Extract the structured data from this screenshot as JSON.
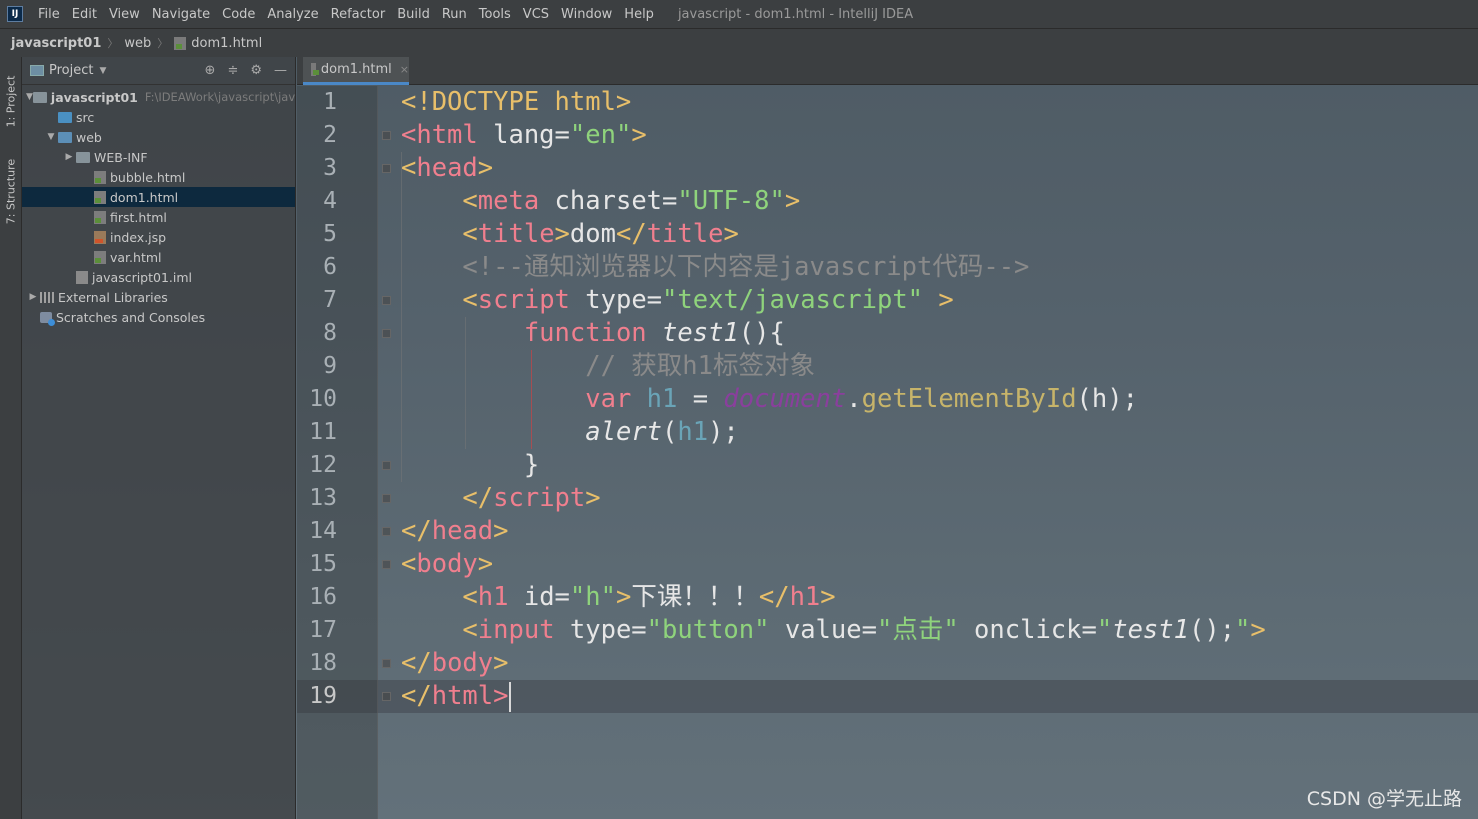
{
  "menubar": {
    "logo": "IJ",
    "items": [
      "File",
      "Edit",
      "View",
      "Navigate",
      "Code",
      "Analyze",
      "Refactor",
      "Build",
      "Run",
      "Tools",
      "VCS",
      "Window",
      "Help"
    ],
    "window_title": "javascript - dom1.html - IntelliJ IDEA"
  },
  "breadcrumb": {
    "project": "javascript01",
    "folder": "web",
    "file": "dom1.html"
  },
  "toolstrip": {
    "project_tab": "1: Project",
    "structure_tab": "7: Structure"
  },
  "project_panel": {
    "title": "Project",
    "tree": [
      {
        "label": "javascript01",
        "extra": "F:\\IDEAWork\\javascript\\jav",
        "icon": "folder-module-icon",
        "depth": 0,
        "arrow": "down"
      },
      {
        "label": "src",
        "icon": "folder-src-icon",
        "depth": 1,
        "arrow": ""
      },
      {
        "label": "web",
        "icon": "folder-web-icon",
        "depth": 1,
        "arrow": "down"
      },
      {
        "label": "WEB-INF",
        "icon": "folder-icon",
        "depth": 2,
        "arrow": "right"
      },
      {
        "label": "bubble.html",
        "icon": "html-file-icon",
        "depth": 3,
        "arrow": ""
      },
      {
        "label": "dom1.html",
        "icon": "html-file-icon",
        "depth": 3,
        "arrow": "",
        "selected": true
      },
      {
        "label": "first.html",
        "icon": "html-file-icon",
        "depth": 3,
        "arrow": ""
      },
      {
        "label": "index.jsp",
        "icon": "jsp-file-icon",
        "depth": 3,
        "arrow": ""
      },
      {
        "label": "var.html",
        "icon": "html-file-icon",
        "depth": 3,
        "arrow": ""
      },
      {
        "label": "javascript01.iml",
        "icon": "iml-file-icon",
        "depth": 2,
        "arrow": ""
      },
      {
        "label": "External Libraries",
        "icon": "library-icon",
        "depth": 0,
        "arrow": "right"
      },
      {
        "label": "Scratches and Consoles",
        "icon": "scratch-icon",
        "depth": 0,
        "arrow": ""
      }
    ]
  },
  "editor": {
    "tab": "dom1.html",
    "current_line": 19,
    "lines": [
      [
        [
          "tg",
          "<!DOCTYPE html>"
        ]
      ],
      [
        [
          "tgn",
          "<html"
        ],
        [
          "at",
          " lang="
        ],
        [
          "av",
          "\"en\""
        ],
        [
          "tg",
          ">"
        ]
      ],
      [
        [
          "tg",
          "<"
        ],
        [
          "tgn",
          "head"
        ],
        [
          "tg",
          ">"
        ]
      ],
      [
        [
          "pl",
          "    "
        ],
        [
          "tg",
          "<"
        ],
        [
          "tgn",
          "meta"
        ],
        [
          "at",
          " charset="
        ],
        [
          "av",
          "\"UTF-8\""
        ],
        [
          "tg",
          ">"
        ]
      ],
      [
        [
          "pl",
          "    "
        ],
        [
          "tg",
          "<"
        ],
        [
          "tgn",
          "title"
        ],
        [
          "tg",
          ">"
        ],
        [
          "pl",
          "dom"
        ],
        [
          "tg",
          "</"
        ],
        [
          "tgn",
          "title"
        ],
        [
          "tg",
          ">"
        ]
      ],
      [
        [
          "pl",
          "    "
        ],
        [
          "cm",
          "<!--通知浏览器以下内容是javascript代码-->"
        ]
      ],
      [
        [
          "pl",
          "    "
        ],
        [
          "tg",
          "<"
        ],
        [
          "tgn",
          "script"
        ],
        [
          "at",
          " type="
        ],
        [
          "av",
          "\"text/javascript\""
        ],
        [
          "tg",
          " >"
        ]
      ],
      [
        [
          "pl",
          "        "
        ],
        [
          "kw",
          "function"
        ],
        [
          "fn",
          " test1"
        ],
        [
          "pl",
          "(){"
        ]
      ],
      [
        [
          "pl",
          "            "
        ],
        [
          "cm",
          "// 获取h1标签对象"
        ]
      ],
      [
        [
          "pl",
          "            "
        ],
        [
          "kw",
          "var"
        ],
        [
          "var",
          " h1"
        ],
        [
          "pl",
          " = "
        ],
        [
          "doc",
          "document"
        ],
        [
          "pl",
          "."
        ],
        [
          "meth",
          "getElementById"
        ],
        [
          "pl",
          "(h);"
        ]
      ],
      [
        [
          "pl",
          "            "
        ],
        [
          "fn",
          "alert"
        ],
        [
          "pl",
          "("
        ],
        [
          "var",
          "h1"
        ],
        [
          "pl",
          ");"
        ]
      ],
      [
        [
          "pl",
          "        }"
        ]
      ],
      [
        [
          "pl",
          "    "
        ],
        [
          "tg",
          "</"
        ],
        [
          "tgn",
          "script"
        ],
        [
          "tg",
          ">"
        ]
      ],
      [
        [
          "tg",
          "</"
        ],
        [
          "tgn",
          "head"
        ],
        [
          "tg",
          ">"
        ]
      ],
      [
        [
          "tg",
          "<"
        ],
        [
          "tgn",
          "body"
        ],
        [
          "tg",
          ">"
        ]
      ],
      [
        [
          "pl",
          "    "
        ],
        [
          "tg",
          "<"
        ],
        [
          "tgn",
          "h1"
        ],
        [
          "at",
          " id="
        ],
        [
          "av",
          "\"h\""
        ],
        [
          "tg",
          ">"
        ],
        [
          "pl",
          "下课！！！"
        ],
        [
          "tg",
          "</"
        ],
        [
          "tgn",
          "h1"
        ],
        [
          "tg",
          ">"
        ]
      ],
      [
        [
          "pl",
          "    "
        ],
        [
          "tg",
          "<"
        ],
        [
          "tgn",
          "input"
        ],
        [
          "at",
          " type="
        ],
        [
          "av",
          "\"button\""
        ],
        [
          "at",
          " value="
        ],
        [
          "av",
          "\"点击\""
        ],
        [
          "at",
          " onclick="
        ],
        [
          "av",
          "\""
        ],
        [
          "fn",
          "test1"
        ],
        [
          "pl",
          "();"
        ],
        [
          "av",
          "\""
        ],
        [
          "tg",
          ">"
        ]
      ],
      [
        [
          "tg",
          "</"
        ],
        [
          "tgn",
          "body"
        ],
        [
          "tg",
          ">"
        ]
      ],
      [
        [
          "tg",
          "</"
        ],
        [
          "tgn",
          "html"
        ],
        [
          "tgn",
          ">"
        ]
      ]
    ]
  },
  "watermark": "CSDN @学无止路"
}
